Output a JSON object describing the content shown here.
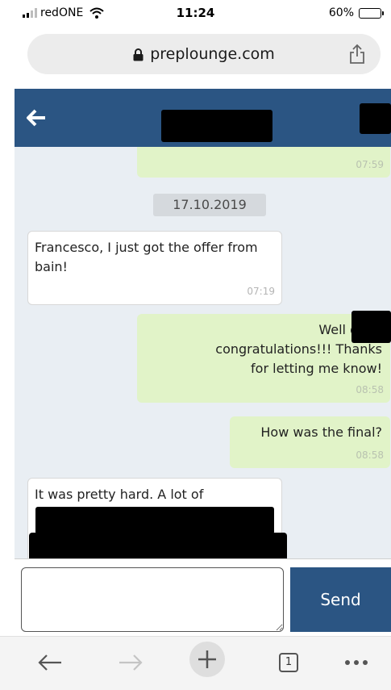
{
  "status_bar": {
    "carrier": "redONE",
    "time": "11:24",
    "battery_percent": "60%",
    "battery_level": 0.6
  },
  "browser": {
    "url": "preplounge.com",
    "open_tabs": "1"
  },
  "chat": {
    "partial_message_time": "07:59",
    "date_divider": "17.10.2019",
    "messages": [
      {
        "direction": "incoming",
        "text": "Francesco, I just got the offer from bain!",
        "time": "07:19"
      },
      {
        "direction": "outgoing",
        "text": "Well done congratulations!!! Thanks for letting me know!",
        "time": "08:58"
      },
      {
        "direction": "outgoing",
        "text": "How was the final?",
        "time": "08:58"
      },
      {
        "direction": "incoming",
        "text": "It was pretty hard. A lot of",
        "time": ""
      }
    ]
  },
  "compose": {
    "send_label": "Send",
    "input_value": ""
  },
  "colors": {
    "header": "#2b5583",
    "chat_bg": "#e9eef3",
    "outgoing_bubble": "#e1f3c8",
    "incoming_bubble": "#ffffff"
  },
  "icons": {
    "back": "arrow-left-icon",
    "share": "share-icon",
    "lock": "lock-icon",
    "nav_back": "browser-back-icon",
    "nav_forward": "browser-forward-icon",
    "new_tab": "plus-icon",
    "tabs": "tabs-icon",
    "more": "more-dots-icon"
  }
}
